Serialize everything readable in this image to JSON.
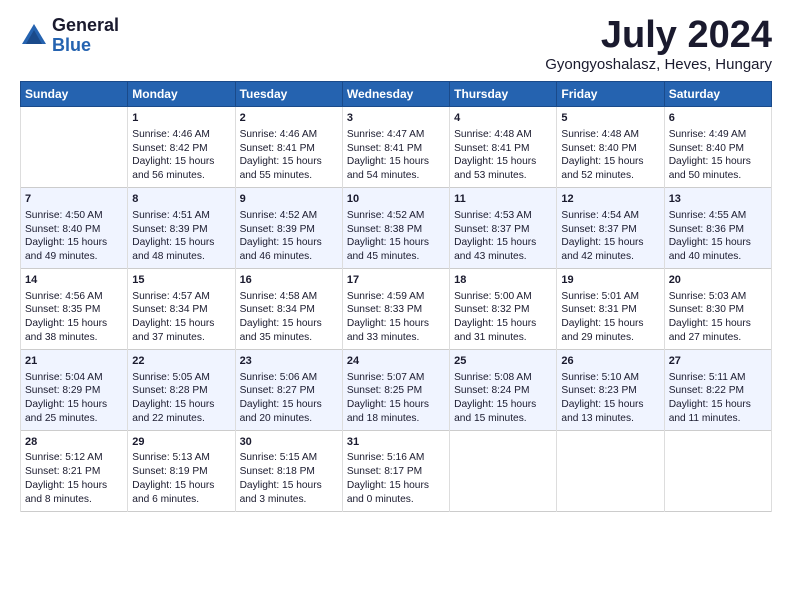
{
  "header": {
    "logo_general": "General",
    "logo_blue": "Blue",
    "title": "July 2024",
    "location": "Gyongyoshalasz, Heves, Hungary"
  },
  "columns": [
    "Sunday",
    "Monday",
    "Tuesday",
    "Wednesday",
    "Thursday",
    "Friday",
    "Saturday"
  ],
  "weeks": [
    [
      {
        "day": "",
        "info": ""
      },
      {
        "day": "1",
        "info": "Sunrise: 4:46 AM\nSunset: 8:42 PM\nDaylight: 15 hours\nand 56 minutes."
      },
      {
        "day": "2",
        "info": "Sunrise: 4:46 AM\nSunset: 8:41 PM\nDaylight: 15 hours\nand 55 minutes."
      },
      {
        "day": "3",
        "info": "Sunrise: 4:47 AM\nSunset: 8:41 PM\nDaylight: 15 hours\nand 54 minutes."
      },
      {
        "day": "4",
        "info": "Sunrise: 4:48 AM\nSunset: 8:41 PM\nDaylight: 15 hours\nand 53 minutes."
      },
      {
        "day": "5",
        "info": "Sunrise: 4:48 AM\nSunset: 8:40 PM\nDaylight: 15 hours\nand 52 minutes."
      },
      {
        "day": "6",
        "info": "Sunrise: 4:49 AM\nSunset: 8:40 PM\nDaylight: 15 hours\nand 50 minutes."
      }
    ],
    [
      {
        "day": "7",
        "info": "Sunrise: 4:50 AM\nSunset: 8:40 PM\nDaylight: 15 hours\nand 49 minutes."
      },
      {
        "day": "8",
        "info": "Sunrise: 4:51 AM\nSunset: 8:39 PM\nDaylight: 15 hours\nand 48 minutes."
      },
      {
        "day": "9",
        "info": "Sunrise: 4:52 AM\nSunset: 8:39 PM\nDaylight: 15 hours\nand 46 minutes."
      },
      {
        "day": "10",
        "info": "Sunrise: 4:52 AM\nSunset: 8:38 PM\nDaylight: 15 hours\nand 45 minutes."
      },
      {
        "day": "11",
        "info": "Sunrise: 4:53 AM\nSunset: 8:37 PM\nDaylight: 15 hours\nand 43 minutes."
      },
      {
        "day": "12",
        "info": "Sunrise: 4:54 AM\nSunset: 8:37 PM\nDaylight: 15 hours\nand 42 minutes."
      },
      {
        "day": "13",
        "info": "Sunrise: 4:55 AM\nSunset: 8:36 PM\nDaylight: 15 hours\nand 40 minutes."
      }
    ],
    [
      {
        "day": "14",
        "info": "Sunrise: 4:56 AM\nSunset: 8:35 PM\nDaylight: 15 hours\nand 38 minutes."
      },
      {
        "day": "15",
        "info": "Sunrise: 4:57 AM\nSunset: 8:34 PM\nDaylight: 15 hours\nand 37 minutes."
      },
      {
        "day": "16",
        "info": "Sunrise: 4:58 AM\nSunset: 8:34 PM\nDaylight: 15 hours\nand 35 minutes."
      },
      {
        "day": "17",
        "info": "Sunrise: 4:59 AM\nSunset: 8:33 PM\nDaylight: 15 hours\nand 33 minutes."
      },
      {
        "day": "18",
        "info": "Sunrise: 5:00 AM\nSunset: 8:32 PM\nDaylight: 15 hours\nand 31 minutes."
      },
      {
        "day": "19",
        "info": "Sunrise: 5:01 AM\nSunset: 8:31 PM\nDaylight: 15 hours\nand 29 minutes."
      },
      {
        "day": "20",
        "info": "Sunrise: 5:03 AM\nSunset: 8:30 PM\nDaylight: 15 hours\nand 27 minutes."
      }
    ],
    [
      {
        "day": "21",
        "info": "Sunrise: 5:04 AM\nSunset: 8:29 PM\nDaylight: 15 hours\nand 25 minutes."
      },
      {
        "day": "22",
        "info": "Sunrise: 5:05 AM\nSunset: 8:28 PM\nDaylight: 15 hours\nand 22 minutes."
      },
      {
        "day": "23",
        "info": "Sunrise: 5:06 AM\nSunset: 8:27 PM\nDaylight: 15 hours\nand 20 minutes."
      },
      {
        "day": "24",
        "info": "Sunrise: 5:07 AM\nSunset: 8:25 PM\nDaylight: 15 hours\nand 18 minutes."
      },
      {
        "day": "25",
        "info": "Sunrise: 5:08 AM\nSunset: 8:24 PM\nDaylight: 15 hours\nand 15 minutes."
      },
      {
        "day": "26",
        "info": "Sunrise: 5:10 AM\nSunset: 8:23 PM\nDaylight: 15 hours\nand 13 minutes."
      },
      {
        "day": "27",
        "info": "Sunrise: 5:11 AM\nSunset: 8:22 PM\nDaylight: 15 hours\nand 11 minutes."
      }
    ],
    [
      {
        "day": "28",
        "info": "Sunrise: 5:12 AM\nSunset: 8:21 PM\nDaylight: 15 hours\nand 8 minutes."
      },
      {
        "day": "29",
        "info": "Sunrise: 5:13 AM\nSunset: 8:19 PM\nDaylight: 15 hours\nand 6 minutes."
      },
      {
        "day": "30",
        "info": "Sunrise: 5:15 AM\nSunset: 8:18 PM\nDaylight: 15 hours\nand 3 minutes."
      },
      {
        "day": "31",
        "info": "Sunrise: 5:16 AM\nSunset: 8:17 PM\nDaylight: 15 hours\nand 0 minutes."
      },
      {
        "day": "",
        "info": ""
      },
      {
        "day": "",
        "info": ""
      },
      {
        "day": "",
        "info": ""
      }
    ]
  ]
}
